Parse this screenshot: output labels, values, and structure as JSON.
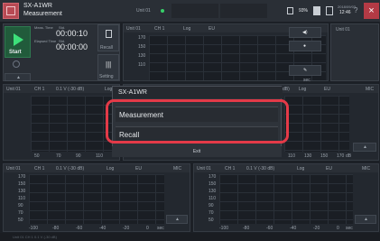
{
  "app": {
    "title_line1": "SX-A1WR",
    "title_line2": "Measurement"
  },
  "topbar": {
    "unit_label": "Unit 01",
    "battery": "93%",
    "datetime_date": "2018/09/03",
    "datetime_time": "12:46",
    "close_label": "×"
  },
  "control": {
    "start_label": "Start",
    "meas_time_label": "Meas. Time",
    "meas_time_unit": "Std.",
    "meas_time_value": "00:00:10",
    "elapsed_label": "Elapsed Time",
    "elapsed_unit": "Std.",
    "elapsed_value": "00:00:00",
    "recall_label": "Recall",
    "setting_label": "Setting"
  },
  "graphs": {
    "top_right": {
      "unit": "Unit 01",
      "ch": "CH 1",
      "mode": "Log",
      "eu": "EU",
      "y_ticks": [
        "170",
        "150",
        "130",
        "110",
        "90",
        "70",
        "50"
      ]
    },
    "middle_left": {
      "unit": "Unit 01",
      "ch": "CH 1",
      "range": "0.1 V (-30 dB)",
      "mode": "Log",
      "x_ticks": [
        "50",
        "70",
        "90",
        "110"
      ]
    },
    "middle_right": {
      "range_tail": "dB)",
      "mode": "Log",
      "eu": "EU",
      "mic": "MIC",
      "x_ticks": [
        "110",
        "130",
        "150",
        "170"
      ],
      "x_unit": "dB"
    },
    "bottom_left": {
      "unit": "Unit 01",
      "ch": "CH 1",
      "range": "0.1 V (-30 dB)",
      "mode": "Log",
      "eu": "EU",
      "mic": "MIC",
      "y_ticks": [
        "170",
        "150",
        "130",
        "110",
        "90",
        "70",
        "50"
      ],
      "x_ticks": [
        "-100",
        "-80",
        "-60",
        "-40",
        "-20",
        "0"
      ],
      "x_unit": "sec"
    },
    "bottom_right": {
      "unit": "Unit 01",
      "ch": "CH 1",
      "range": "0.1 V (-30 dB)",
      "mode": "Log",
      "eu": "EU",
      "mic": "MIC",
      "y_ticks": [
        "170",
        "150",
        "130",
        "110",
        "90",
        "70",
        "50"
      ],
      "x_ticks": [
        "-100",
        "-80",
        "-60",
        "-40",
        "-20",
        "0"
      ],
      "x_unit": "sec"
    },
    "mini": {
      "unit": "Unit 01",
      "ch": "CH 1",
      "x_unit": "sec"
    }
  },
  "dialog": {
    "title": "SX-A1WR",
    "item1": "Measurement",
    "item2": "Recall",
    "exit": "Exit"
  },
  "status": {
    "text": "Unit 01  CH 1  0.1 V (-30 dB)"
  },
  "colors": {
    "accent_red": "#e43a48",
    "start_green": "#3de07a"
  }
}
